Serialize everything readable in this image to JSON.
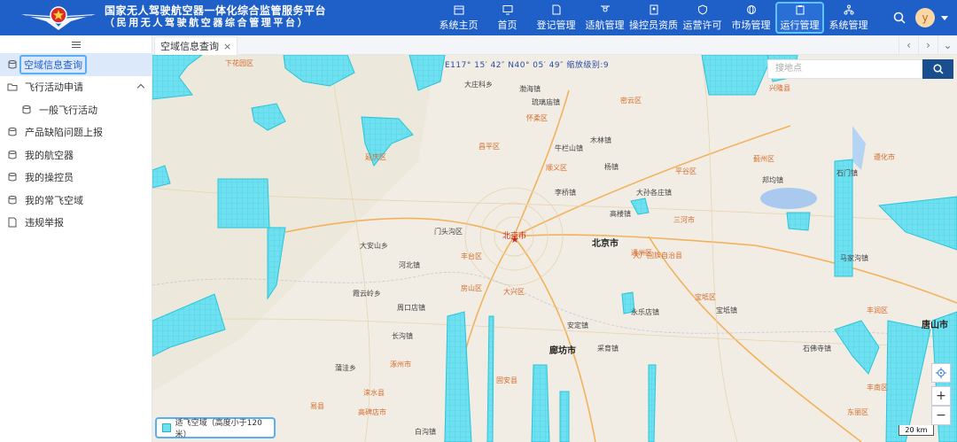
{
  "header": {
    "title_main": "国家无人驾驶航空器一体化综合监管服务平台",
    "title_sub": "（民用无人驾驶航空器综合管理平台）",
    "nav": [
      {
        "label": "系统主页",
        "icon": "calendar-icon"
      },
      {
        "label": "首页",
        "icon": "monitor-icon"
      },
      {
        "label": "登记管理",
        "icon": "document-icon"
      },
      {
        "label": "适航管理",
        "icon": "drone-icon"
      },
      {
        "label": "操控员资质",
        "icon": "id-card-icon"
      },
      {
        "label": "运营许可",
        "icon": "shield-icon"
      },
      {
        "label": "市场管理",
        "icon": "globe-icon"
      },
      {
        "label": "运行管理",
        "icon": "clipboard-icon",
        "active": true
      },
      {
        "label": "系统管理",
        "icon": "network-icon"
      }
    ],
    "avatar_letter": "y"
  },
  "sidebar": {
    "items": [
      {
        "label": "空域信息查询",
        "active": true
      },
      {
        "label": "飞行活动申请",
        "expanded": true
      },
      {
        "label": "一般飞行活动",
        "sub": true
      },
      {
        "label": "产品缺陷问题上报"
      },
      {
        "label": "我的航空器"
      },
      {
        "label": "我的操控员"
      },
      {
        "label": "我的常飞空域"
      },
      {
        "label": "违规举报"
      }
    ]
  },
  "tabs": [
    {
      "label": "空域信息查询",
      "close": "×"
    }
  ],
  "map": {
    "coordinate_text": "E117° 15′ 42″  N40° 05′ 49″  缩放级别:9",
    "search_placeholder": "搜地点",
    "scale_label": "20 km",
    "legend_label": "适飞空域（高度小于120米）",
    "colors": {
      "airspace": "#6ee0f0",
      "airspace_edge": "#29c3d6",
      "land": "#f1ede4"
    },
    "labels": [
      {
        "text": "北京市",
        "type": "big"
      },
      {
        "text": "北京市",
        "type": "red"
      },
      {
        "text": "廊坊市",
        "type": "big"
      },
      {
        "text": "唐山市",
        "type": "big"
      },
      {
        "text": "大兴区",
        "type": "orange"
      },
      {
        "text": "丰台区",
        "type": "orange"
      },
      {
        "text": "房山区",
        "type": "orange"
      },
      {
        "text": "昌平区",
        "type": "orange"
      },
      {
        "text": "顺义区",
        "type": "orange"
      },
      {
        "text": "通州区",
        "type": "orange"
      },
      {
        "text": "怀柔区",
        "type": "orange"
      },
      {
        "text": "密云区",
        "type": "orange"
      },
      {
        "text": "平谷区",
        "type": "orange"
      },
      {
        "text": "门头沟区",
        "type": "normal"
      },
      {
        "text": "三河市",
        "type": "orange"
      },
      {
        "text": "大厂回族自治县",
        "type": "orange"
      },
      {
        "text": "宝坻区",
        "type": "orange"
      },
      {
        "text": "固安县",
        "type": "orange"
      },
      {
        "text": "涿州市",
        "type": "orange"
      },
      {
        "text": "高碑店市",
        "type": "orange"
      },
      {
        "text": "涞水县",
        "type": "orange"
      },
      {
        "text": "易县",
        "type": "orange"
      },
      {
        "text": "蓟州区",
        "type": "orange"
      },
      {
        "text": "丰南区",
        "type": "orange"
      },
      {
        "text": "丰润区",
        "type": "orange"
      },
      {
        "text": "兴隆县",
        "type": "orange"
      },
      {
        "text": "下花园区",
        "type": "orange"
      },
      {
        "text": "延庆区",
        "type": "orange"
      },
      {
        "text": "遵化市",
        "type": "orange"
      },
      {
        "text": "东丽区",
        "type": "orange"
      },
      {
        "text": "大庄科乡",
        "type": "normal"
      },
      {
        "text": "渤海镇",
        "type": "normal"
      },
      {
        "text": "琉璃庙镇",
        "type": "normal"
      },
      {
        "text": "木林镇",
        "type": "normal"
      },
      {
        "text": "杨镇",
        "type": "normal"
      },
      {
        "text": "李桥镇",
        "type": "normal"
      },
      {
        "text": "高楼镇",
        "type": "normal"
      },
      {
        "text": "大安山乡",
        "type": "normal"
      },
      {
        "text": "河北镇",
        "type": "normal"
      },
      {
        "text": "周口店镇",
        "type": "normal"
      },
      {
        "text": "长沟镇",
        "type": "normal"
      },
      {
        "text": "蒲洼乡",
        "type": "normal"
      },
      {
        "text": "霞云岭乡",
        "type": "normal"
      },
      {
        "text": "白沟镇",
        "type": "normal"
      },
      {
        "text": "永乐店镇",
        "type": "normal"
      },
      {
        "text": "安定镇",
        "type": "normal"
      },
      {
        "text": "采育镇",
        "type": "normal"
      },
      {
        "text": "牛栏山镇",
        "type": "normal"
      },
      {
        "text": "大孙各庄镇",
        "type": "normal"
      },
      {
        "text": "石门镇",
        "type": "normal"
      },
      {
        "text": "邦均镇",
        "type": "normal"
      },
      {
        "text": "宝坻镇",
        "type": "normal"
      },
      {
        "text": "马家沟镇",
        "type": "normal"
      },
      {
        "text": "石佛寺镇",
        "type": "normal"
      }
    ]
  }
}
